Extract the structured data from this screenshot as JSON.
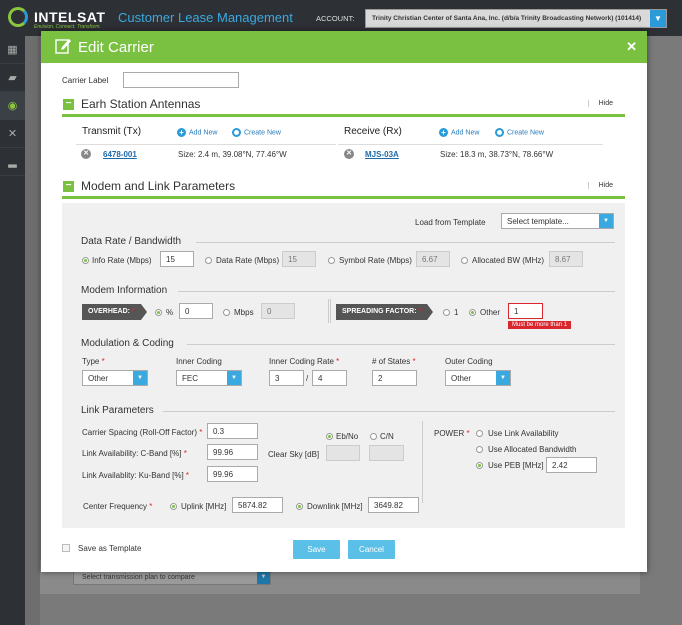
{
  "app": {
    "logo_text": "INTELSAT",
    "logo_tagline": "Envision. Connect. Transform.",
    "title": "Customer Lease Management",
    "account_label": "ACCOUNT:",
    "account_value": "Trinity Christian Center of Santa Ana, Inc. (d/b/a Trinity Broadcasting Network) (101414)"
  },
  "background": {
    "transmission_plan_placeholder": "Select transmission plan to compare"
  },
  "modal": {
    "title": "Edit Carrier",
    "carrier_label": "Carrier Label",
    "carrier_label_value": "",
    "earth_station": {
      "title": "Earh Station Antennas",
      "hide": "Hide",
      "tx": {
        "title": "Transmit (Tx)",
        "add_new": "Add New",
        "create_new": "Create New",
        "code": "6478-001",
        "size": "Size: 2.4 m, 39.08°N, 77.46°W"
      },
      "rx": {
        "title": "Receive (Rx)",
        "add_new": "Add New",
        "create_new": "Create New",
        "code": "MJS-03A",
        "size": "Size: 18.3 m, 38.73°N, 78.66°W"
      }
    },
    "modem": {
      "title": "Modem and Link Parameters",
      "hide": "Hide",
      "load_template": "Load from Template",
      "template_placeholder": "Select template...",
      "data_rate": {
        "title": "Data Rate / Bandwidth",
        "info_rate_label": "Info Rate (Mbps)",
        "info_rate_value": "15",
        "data_rate_label": "Data Rate (Mbps)",
        "data_rate_value": "15",
        "symbol_rate_label": "Symbol Rate (Mbps)",
        "symbol_rate_value": "6.67",
        "allocated_bw_label": "Allocated BW (MHz)",
        "allocated_bw_value": "8.67"
      },
      "modem_info": {
        "title": "Modem Information",
        "overhead_label": "OVERHEAD:",
        "percent_label": "%",
        "percent_value": "0",
        "mbps_label": "Mbps",
        "mbps_value": "0",
        "spreading_label": "SPREADING FACTOR:",
        "one_label": "1",
        "other_label": "Other",
        "other_value": "1",
        "error": "Must be more than 1"
      },
      "modulation": {
        "title": "Modulation & Coding",
        "type_label": "Type",
        "type_value": "Other",
        "inner_coding_label": "Inner Coding",
        "inner_coding_value": "FEC",
        "inner_rate_label": "Inner Coding Rate",
        "inner_rate_num": "3",
        "inner_rate_sep": "/",
        "inner_rate_den": "4",
        "states_label": "# of States",
        "states_value": "2",
        "outer_coding_label": "Outer Coding",
        "outer_coding_value": "Other"
      },
      "link": {
        "title": "Link Parameters",
        "carrier_spacing_label": "Carrier Spacing (Roll-Off Factor)",
        "carrier_spacing_value": "0.3",
        "c_band_label": "Link Availability: C-Band [%]",
        "c_band_value": "99.96",
        "ku_band_label": "Link Availablity: Ku-Band [%]",
        "ku_band_value": "99.96",
        "ebno_label": "Eb/No",
        "cn_label": "C/N",
        "clear_sky_label": "Clear Sky [dB]",
        "power_label": "POWER",
        "power_opt1": "Use Link Availability",
        "power_opt2": "Use Allocated Bandwidth",
        "power_opt3": "Use PEB [MHz]",
        "peb_value": "2.42",
        "center_freq_label": "Center Frequency",
        "uplink_label": "Uplink [MHz]",
        "uplink_value": "5874.82",
        "downlink_label": "Downlink [MHz]",
        "downlink_value": "3649.82"
      }
    },
    "save_template": "Save as Template",
    "save": "Save",
    "cancel": "Cancel"
  }
}
